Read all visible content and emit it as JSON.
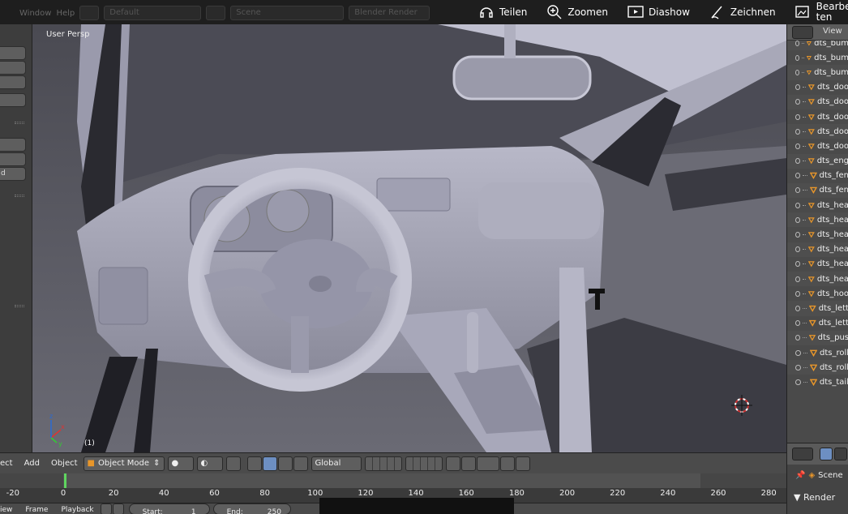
{
  "blender_header": {
    "window_menu": "Window",
    "help_menu": "Help",
    "layout": "Default",
    "scene": "Scene",
    "renderer": "Blender Render"
  },
  "photo_toolbar": {
    "share": "Teilen",
    "zoom": "Zoomen",
    "slideshow": "Diashow",
    "draw": "Zeichnen",
    "edit": "Bearbei-\nten"
  },
  "left_shelf": {
    "labels": [
      "",
      "",
      "",
      "",
      "",
      "",
      "d",
      ""
    ]
  },
  "viewport": {
    "view_label": "User Persp",
    "frame_label": "(1)"
  },
  "outliner": {
    "view_menu": "View",
    "items": [
      "dts_bum",
      "dts_bum",
      "dts_bum",
      "dts_doo",
      "dts_doo",
      "dts_doo",
      "dts_doo",
      "dts_doo",
      "dts_eng",
      "dts_fen",
      "dts_fen",
      "dts_hea",
      "dts_hea",
      "dts_hea",
      "dts_hea",
      "dts_hea",
      "dts_hea",
      "dts_hoo",
      "dts_lett",
      "dts_lett",
      "dts_pus",
      "dts_roll",
      "dts_roll",
      "dts_tail"
    ]
  },
  "properties": {
    "scene_label": "Scene",
    "render_panel": "▼ Render"
  },
  "viewport_header": {
    "object_menu_partial": "ect",
    "add_menu": "Add",
    "object_menu": "Object",
    "mode": "Object Mode",
    "orientation": "Global"
  },
  "timeline": {
    "ticks": [
      -20,
      0,
      20,
      40,
      60,
      80,
      100,
      120,
      140,
      160,
      180,
      200,
      220,
      240,
      260,
      280
    ],
    "current_frame": 1,
    "start_label": "Start:",
    "start_value": "1",
    "end_label": "End:",
    "end_value": "250",
    "view_menu": "iew",
    "frame_menu": "Frame",
    "playback_menu": "Playback"
  },
  "colors": {
    "accent_blue": "#6d8fc2",
    "frame_cursor": "#5fd55f",
    "outliner_icon": "#e8962a"
  }
}
